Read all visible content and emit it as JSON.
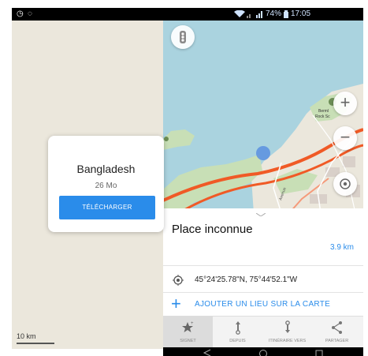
{
  "left_screen": {
    "status_icons": [
      "alarm-icon",
      "whatsapp-icon"
    ],
    "scale_label": "10 km",
    "download_card": {
      "country": "Bangladesh",
      "size": "26 Mo",
      "button_label": "TÉLÉCHARGER"
    }
  },
  "right_screen": {
    "status": {
      "battery_percent": "74%",
      "time": "17:05"
    },
    "map": {
      "poi_label_line1": "Berml",
      "poi_label_line2": "Rock Sc",
      "street_label": "Avenue"
    },
    "place": {
      "title": "Place inconnue",
      "distance": "3.9 km",
      "coordinates": "45°24'25.78\"N, 75°44'52.1\"W",
      "add_place_label": "AJOUTER UN LIEU SUR LA CARTE"
    },
    "bottom_bar": [
      {
        "label": "SIGNET",
        "icon": "star-icon"
      },
      {
        "label": "DEPUIS",
        "icon": "route-from-icon"
      },
      {
        "label": "ITINÉRAIRE VERS",
        "icon": "route-to-icon"
      },
      {
        "label": "PARTAGER",
        "icon": "share-icon"
      }
    ]
  },
  "colors": {
    "accent": "#2a8cea",
    "water": "#aad3df",
    "land": "#ebe7dc",
    "park": "#c8dfb6",
    "road": "#f05a26"
  }
}
